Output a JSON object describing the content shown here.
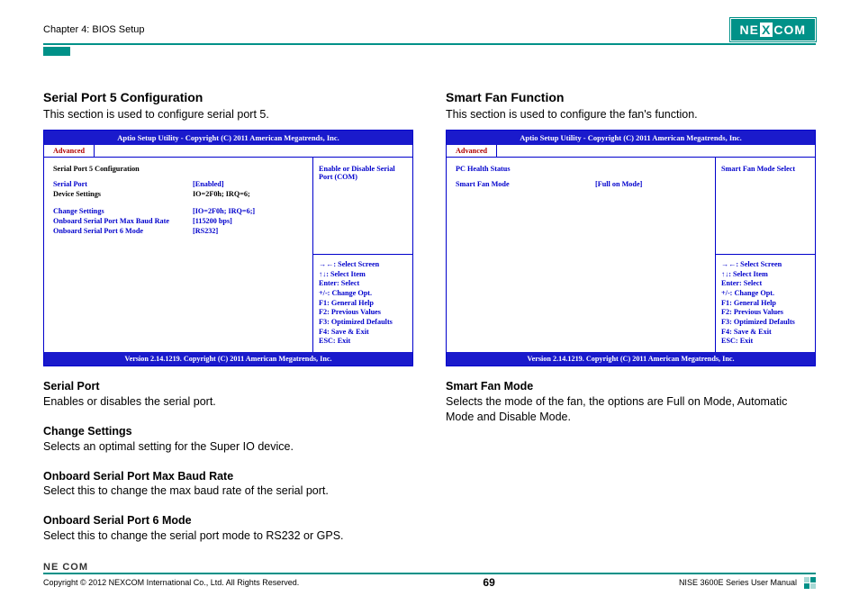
{
  "header": {
    "chapter": "Chapter 4: BIOS Setup",
    "logo_left": "NE",
    "logo_mid": "X",
    "logo_right": "COM"
  },
  "left": {
    "title": "Serial Port 5 Configuration",
    "desc": "This section is used to configure serial port 5.",
    "bios": {
      "header": "Aptio Setup Utility - Copyright (C) 2011 American Megatrends, Inc.",
      "tab": "Advanced",
      "section_label": "Serial Port 5 Configuration",
      "rows": [
        {
          "label": "Serial Port",
          "value": "[Enabled]"
        },
        {
          "label": "Device Settings",
          "value": "IO=2F0h; IRQ=6;"
        }
      ],
      "rows2": [
        {
          "label": "Change Settings",
          "value": "[IO=2F0h; IRQ=6;]"
        },
        {
          "label": "Onboard Serial Port Max Baud Rate",
          "value": "[115200 bps]"
        },
        {
          "label": "Onboard Serial Port 6 Mode",
          "value": "[RS232]"
        }
      ],
      "help": "Enable or Disable Serial Port (COM)",
      "keys": [
        "→←: Select Screen",
        "↑↓: Select Item",
        "Enter: Select",
        "+/-: Change Opt.",
        "F1: General Help",
        "F2: Previous Values",
        "F3: Optimized Defaults",
        "F4: Save & Exit",
        "ESC: Exit"
      ],
      "footer": "Version 2.14.1219. Copyright (C) 2011 American Megatrends, Inc."
    },
    "paras": [
      {
        "title": "Serial Port",
        "body": "Enables or disables the serial port."
      },
      {
        "title": "Change Settings",
        "body": "Selects an optimal setting for the Super IO device."
      },
      {
        "title": "Onboard Serial Port Max Baud Rate",
        "body": "Select this to change the max baud rate of the serial port."
      },
      {
        "title": "Onboard Serial Port 6 Mode",
        "body": "Select this to change the serial port mode to RS232 or GPS."
      }
    ]
  },
  "right": {
    "title": "Smart Fan Function",
    "desc": "This section is used to configure the fan's function.",
    "bios": {
      "header": "Aptio Setup Utility - Copyright (C) 2011 American Megatrends, Inc.",
      "tab": "Advanced",
      "section_label": "PC Health Status",
      "rows": [
        {
          "label": "Smart Fan Mode",
          "value": "[Full on Mode]"
        }
      ],
      "help": "Smart Fan Mode Select",
      "keys": [
        "→←: Select Screen",
        "↑↓: Select Item",
        "Enter: Select",
        "+/-: Change Opt.",
        "F1: General Help",
        "F2: Previous Values",
        "F3: Optimized Defaults",
        "F4: Save & Exit",
        "ESC: Exit"
      ],
      "footer": "Version 2.14.1219. Copyright (C) 2011 American Megatrends, Inc."
    },
    "paras": [
      {
        "title": "Smart Fan Mode",
        "body": "Selects the mode of the fan, the options are Full on Mode, Automatic Mode and Disable Mode."
      }
    ]
  },
  "footer": {
    "mini_logo": "NE COM",
    "copyright": "Copyright © 2012 NEXCOM International Co., Ltd. All Rights Reserved.",
    "page": "69",
    "manual": "NISE 3600E Series User Manual"
  }
}
